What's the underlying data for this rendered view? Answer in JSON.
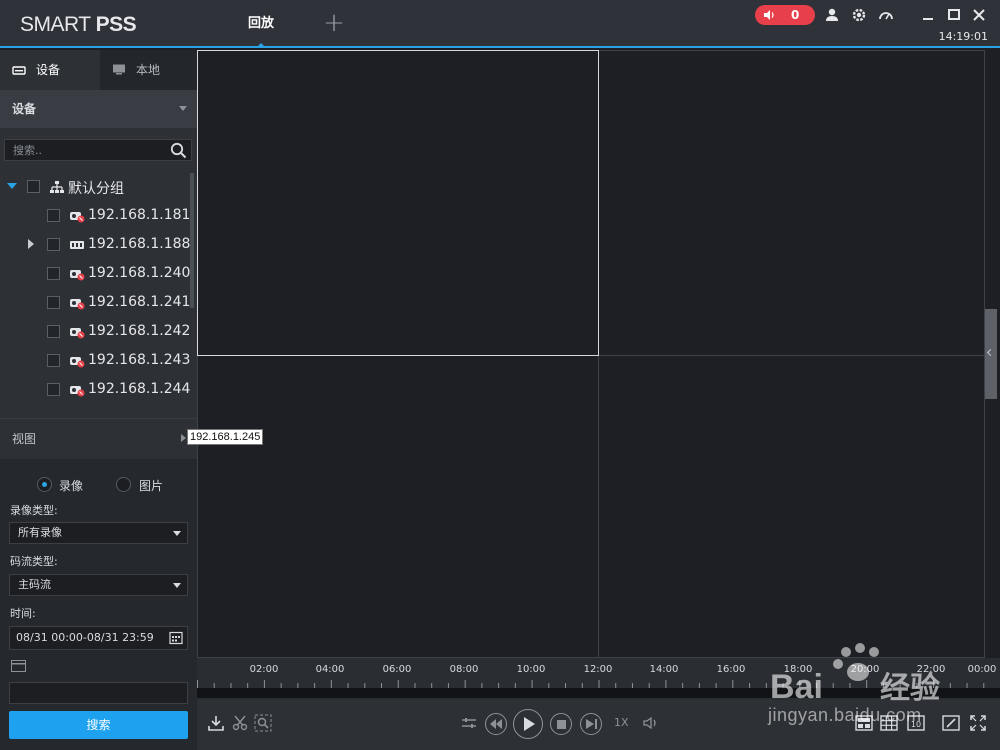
{
  "app": {
    "logo_thin": "SMART ",
    "logo_bold": "PSS",
    "active_tab": "回放",
    "alarm_count": "0",
    "clock": "14:19:01",
    "accent": "#29a3e3",
    "alarm_color": "#e8404a"
  },
  "panel": {
    "tab_device": "设备",
    "tab_local": "本地",
    "device_section": "设备",
    "search_placeholder": "搜索..",
    "view_section": "视图",
    "tooltip": "192.168.1.245"
  },
  "tree": {
    "group": "默认分组",
    "devices": [
      {
        "ip": "192.168.1.181",
        "status": "offline"
      },
      {
        "ip": "192.168.1.188",
        "status": "online"
      },
      {
        "ip": "192.168.1.240",
        "status": "offline"
      },
      {
        "ip": "192.168.1.241",
        "status": "offline"
      },
      {
        "ip": "192.168.1.242",
        "status": "offline"
      },
      {
        "ip": "192.168.1.243",
        "status": "offline"
      },
      {
        "ip": "192.168.1.244",
        "status": "offline"
      }
    ]
  },
  "search": {
    "radio_video": "录像",
    "radio_picture": "图片",
    "record_type_label": "录像类型:",
    "record_type_value": "所有录像",
    "stream_type_label": "码流类型:",
    "stream_type_value": "主码流",
    "time_label": "时间:",
    "time_value": "08/31 00:00-08/31 23:59",
    "search_button": "搜索"
  },
  "timeline": {
    "labels": [
      "02:00",
      "04:00",
      "06:00",
      "08:00",
      "10:00",
      "12:00",
      "14:00",
      "16:00",
      "18:00",
      "20:00",
      "22:00",
      "00:00"
    ]
  },
  "controls": {
    "speed": "1X"
  },
  "watermark": {
    "brand": "Bai",
    "brand_cn": "经验",
    "url": "jingyan.baidu.com"
  }
}
